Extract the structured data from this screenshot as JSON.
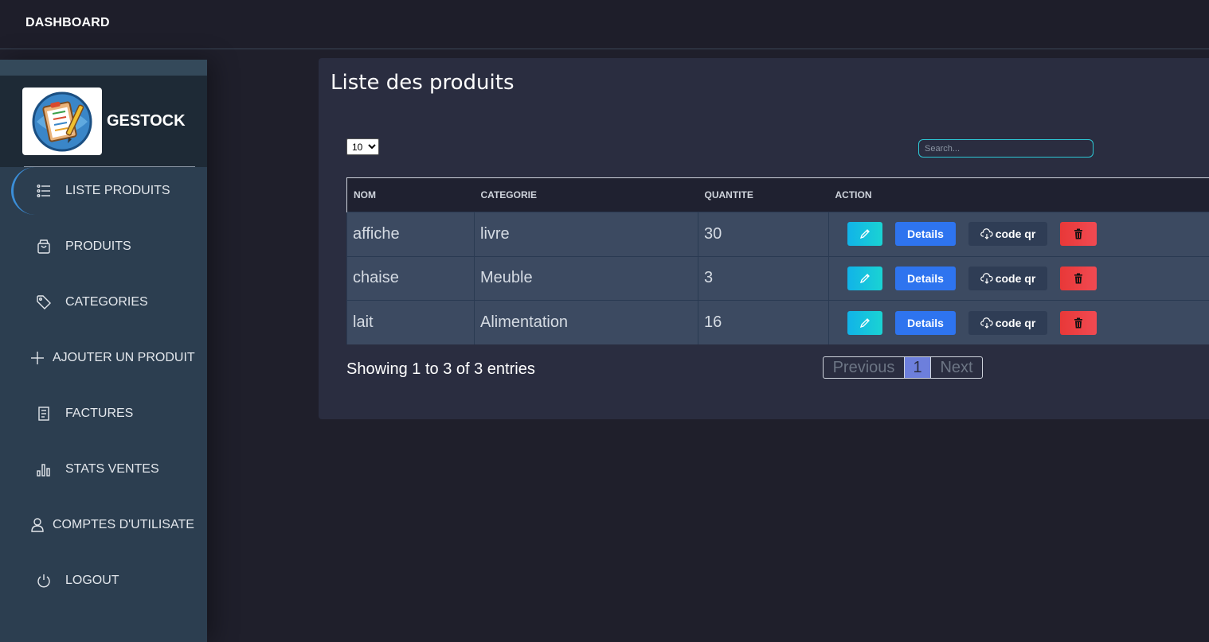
{
  "topbar": {
    "title": "DASHBOARD"
  },
  "sidebar": {
    "brand": "GESTOCK",
    "items": [
      {
        "label": "LISTE PRODUITS",
        "icon": "list-icon",
        "active": true
      },
      {
        "label": "PRODUITS",
        "icon": "shopping-bag-icon"
      },
      {
        "label": "CATEGORIES",
        "icon": "tag-icon"
      },
      {
        "label": "AJOUTER UN PRODUIT",
        "icon": "plus-icon"
      },
      {
        "label": "FACTURES",
        "icon": "receipt-icon"
      },
      {
        "label": "STATS VENTES",
        "icon": "bar-chart-icon"
      },
      {
        "label": "COMPTES D'UTILISATE",
        "icon": "user-icon"
      },
      {
        "label": "LOGOUT",
        "icon": "power-icon"
      }
    ]
  },
  "main": {
    "title": "Liste des produits",
    "page_length": {
      "selected": "10"
    },
    "search": {
      "placeholder": "Search..."
    },
    "table": {
      "columns": [
        "NOM",
        "CATEGORIE",
        "QUANTITE",
        "ACTION"
      ],
      "rows": [
        {
          "nom": "affiche",
          "categorie": "livre",
          "quantite": "30"
        },
        {
          "nom": "chaise",
          "categorie": "Meuble",
          "quantite": "3"
        },
        {
          "nom": "lait",
          "categorie": "Alimentation",
          "quantite": "16"
        }
      ],
      "actions": {
        "details": "Details",
        "qr": "code qr"
      }
    },
    "info": "Showing 1 to 3 of 3 entries",
    "pagination": {
      "previous": "Previous",
      "current": "1",
      "next": "Next"
    }
  },
  "colors": {
    "accent": "#2e74ef",
    "danger": "#e83838",
    "cyan": "#1ad3d3",
    "sidebar": "#2c3e50"
  }
}
